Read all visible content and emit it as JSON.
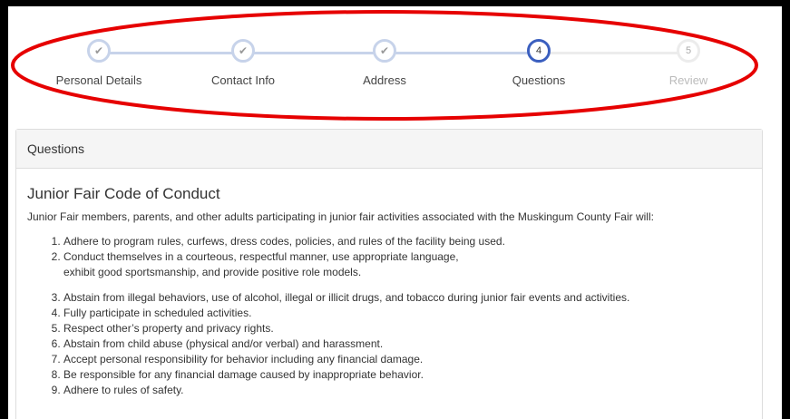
{
  "stepper": {
    "steps": [
      {
        "label": "Personal Details",
        "state": "done",
        "marker": "check-icon"
      },
      {
        "label": "Contact Info",
        "state": "done",
        "marker": "check-icon"
      },
      {
        "label": "Address",
        "state": "done",
        "marker": "check-icon"
      },
      {
        "label": "Questions",
        "state": "active",
        "number": "4"
      },
      {
        "label": "Review",
        "state": "todo",
        "number": "5"
      }
    ],
    "colors": {
      "done": "#c7d3ea",
      "active": "#3b5fbf",
      "todo": "#ececec",
      "annotation": "#e60000"
    }
  },
  "panel": {
    "heading": "Questions",
    "section_title": "Junior Fair Code of Conduct",
    "intro": "Junior Fair members, parents, and other adults participating in junior fair activities associated with the Muskingum County Fair will:",
    "rules": [
      "Adhere to program rules, curfews, dress codes, policies, and rules of the facility being used.",
      "Conduct themselves in a courteous, respectful manner, use appropriate language, exhibit good sportsmanship, and provide positive role models.",
      "Abstain from illegal behaviors, use of alcohol, illegal or illicit drugs, and tobacco during junior fair events and activities.",
      "Fully participate in scheduled activities.",
      "Respect other’s property and privacy rights.",
      "Abstain from child abuse (physical and/or verbal) and harassment.",
      "Accept personal responsibility for behavior including any financial damage.",
      "Be responsible for any financial damage caused by inappropriate behavior.",
      "Adhere to rules of safety."
    ]
  }
}
